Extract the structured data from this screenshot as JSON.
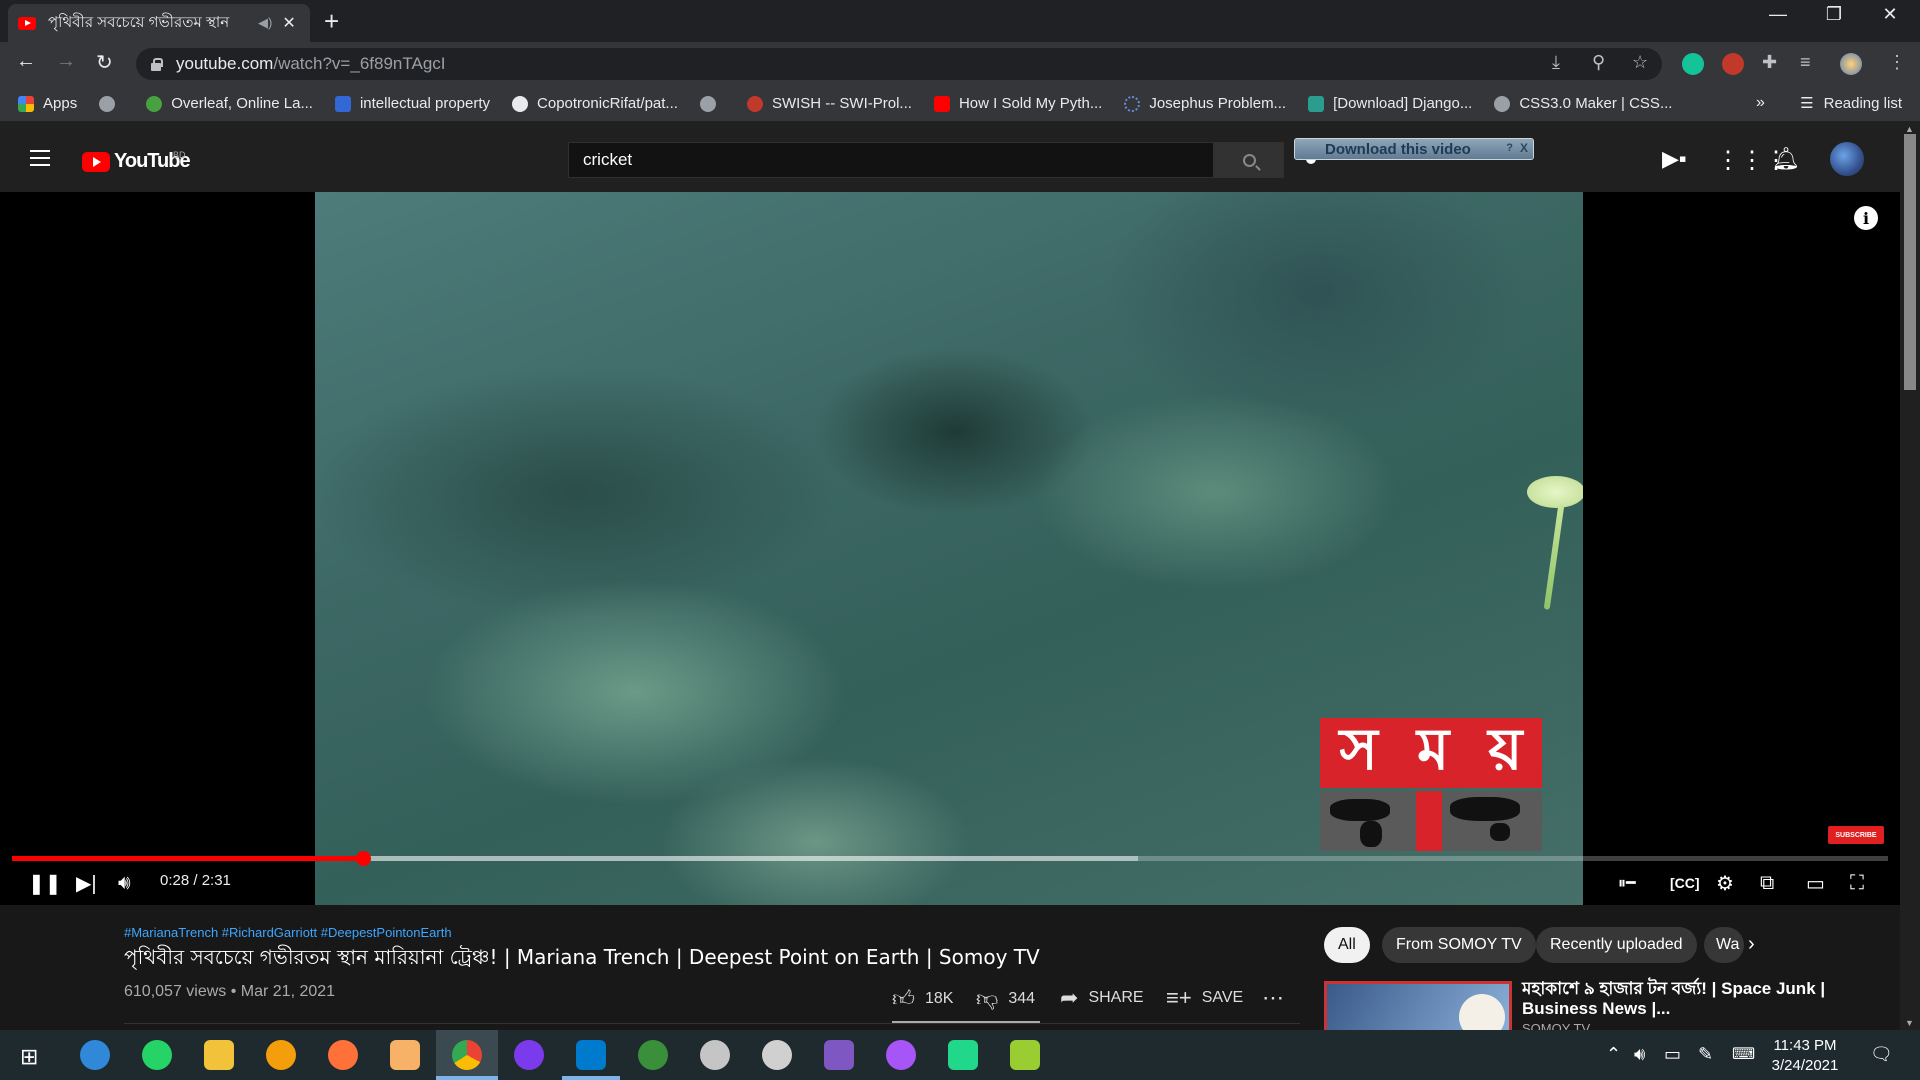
{
  "browser": {
    "tab_title": "পৃথিবীর সবচেয়ে গভীরতম স্থান",
    "url_host": "youtube.com",
    "url_path": "/watch?v=_6f89nTAgcI",
    "reading_list": "Reading list",
    "bookmarks_more": "»",
    "bookmarks": [
      {
        "label": "Apps",
        "color": "#4285f4"
      },
      {
        "label": "",
        "color": "#9aa0a6"
      },
      {
        "label": "Overleaf, Online La...",
        "color": "#47a141"
      },
      {
        "label": "intellectual property",
        "color": "#3367d6"
      },
      {
        "label": "CopotronicRifat/pat...",
        "color": "#e8eaed"
      },
      {
        "label": "",
        "color": "#9aa0a6"
      },
      {
        "label": "SWISH -- SWI-Prol...",
        "color": "#c0392b"
      },
      {
        "label": "How I Sold My Pyth...",
        "color": "#ff0000"
      },
      {
        "label": "Josephus Problem...",
        "color": "#3b5998"
      },
      {
        "label": "[Download] Django...",
        "color": "#2a9d8f"
      },
      {
        "label": "CSS3.0 Maker | CSS...",
        "color": "#9aa0a6"
      }
    ]
  },
  "youtube": {
    "logo_text": "YouTube",
    "country": "BD",
    "search_value": "cricket",
    "download_label": "Download this video",
    "download_help": "?",
    "download_close": "X"
  },
  "player": {
    "current_time": "0:28",
    "duration": "2:31",
    "time_display": "0:28 / 2:31",
    "progress_fraction": 0.187,
    "buffer_fraction": 0.6,
    "watermark_letters": [
      "স",
      "ম",
      "য়"
    ],
    "subscribe_badge": "SUBSCRIBE"
  },
  "video": {
    "hashtags": "#MarianaTrench #RichardGarriott #DeepestPointonEarth",
    "title": "পৃথিবীর সবচেয়ে গভীরতম স্থান মারিয়ানা ট্রেঞ্চ! | Mariana Trench | Deepest Point on Earth | Somoy TV",
    "views": "610,057 views • Mar 21, 2021",
    "likes": "18K",
    "dislikes": "344",
    "share": "SHARE",
    "save": "SAVE"
  },
  "chips": [
    {
      "label": "All",
      "selected": true
    },
    {
      "label": "From SOMOY TV",
      "selected": false
    },
    {
      "label": "Recently uploaded",
      "selected": false
    },
    {
      "label": "Wa",
      "selected": false
    }
  ],
  "related": {
    "title": "মহাকাশে ৯ হাজার টন বর্জ্য! | Space Junk | Business News |...",
    "channel": "SOMOY TV"
  },
  "taskbar": {
    "time": "11:43 PM",
    "date": "3/24/2021"
  }
}
